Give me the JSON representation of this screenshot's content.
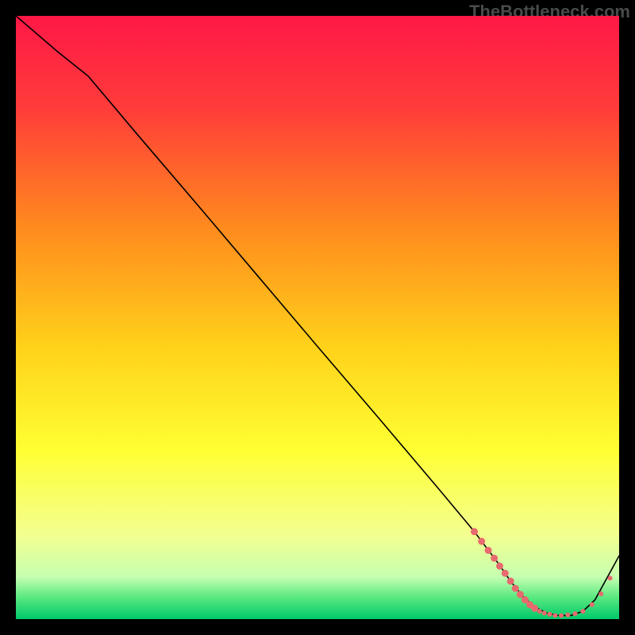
{
  "watermark": "TheBottleneck.com",
  "chart_data": {
    "type": "line",
    "title": "",
    "xlabel": "",
    "ylabel": "",
    "xlim": [
      0,
      100
    ],
    "ylim": [
      0,
      100
    ],
    "grid": false,
    "legend": false,
    "gradient_stops": [
      {
        "offset": 0.0,
        "color": "#ff1846"
      },
      {
        "offset": 0.15,
        "color": "#ff3b3a"
      },
      {
        "offset": 0.35,
        "color": "#ff8a1e"
      },
      {
        "offset": 0.55,
        "color": "#ffd21a"
      },
      {
        "offset": 0.72,
        "color": "#ffff33"
      },
      {
        "offset": 0.86,
        "color": "#f3ff8f"
      },
      {
        "offset": 0.93,
        "color": "#c6ffb0"
      },
      {
        "offset": 0.965,
        "color": "#56e87f"
      },
      {
        "offset": 1.0,
        "color": "#00c96a"
      }
    ],
    "series": [
      {
        "name": "curve",
        "stroke": "#000000",
        "stroke_width": 1.6,
        "x": [
          0,
          7,
          12,
          20,
          30,
          40,
          50,
          60,
          70,
          76,
          80,
          82,
          84,
          86,
          88,
          90,
          92,
          94,
          96,
          100
        ],
        "y": [
          100,
          94,
          90,
          80.5,
          68.8,
          57,
          45.2,
          33.5,
          21.7,
          14.5,
          9.2,
          6.3,
          3.8,
          2.0,
          1.0,
          0.6,
          0.6,
          1.3,
          3.2,
          10.5
        ]
      }
    ],
    "markers": {
      "color": "#e86a6f",
      "radius_small": 3.0,
      "radius_large": 4.5,
      "points": [
        {
          "x": 76.0,
          "y": 14.5,
          "r": "large"
        },
        {
          "x": 77.2,
          "y": 12.9,
          "r": "large"
        },
        {
          "x": 78.3,
          "y": 11.4,
          "r": "large"
        },
        {
          "x": 79.3,
          "y": 10.1,
          "r": "large"
        },
        {
          "x": 80.2,
          "y": 8.8,
          "r": "large"
        },
        {
          "x": 81.1,
          "y": 7.6,
          "r": "large"
        },
        {
          "x": 82.0,
          "y": 6.3,
          "r": "large"
        },
        {
          "x": 82.8,
          "y": 5.1,
          "r": "large"
        },
        {
          "x": 83.6,
          "y": 4.1,
          "r": "large"
        },
        {
          "x": 84.4,
          "y": 3.2,
          "r": "large"
        },
        {
          "x": 85.2,
          "y": 2.4,
          "r": "large"
        },
        {
          "x": 86.0,
          "y": 1.8,
          "r": "large"
        },
        {
          "x": 86.8,
          "y": 1.3,
          "r": "small"
        },
        {
          "x": 87.6,
          "y": 1.0,
          "r": "small"
        },
        {
          "x": 88.5,
          "y": 0.8,
          "r": "small"
        },
        {
          "x": 89.4,
          "y": 0.6,
          "r": "small"
        },
        {
          "x": 90.4,
          "y": 0.6,
          "r": "small"
        },
        {
          "x": 91.5,
          "y": 0.7,
          "r": "small"
        },
        {
          "x": 92.7,
          "y": 0.9,
          "r": "small"
        },
        {
          "x": 94.0,
          "y": 1.3,
          "r": "small"
        },
        {
          "x": 95.5,
          "y": 2.4,
          "r": "small"
        },
        {
          "x": 97.0,
          "y": 4.2,
          "r": "small"
        },
        {
          "x": 98.5,
          "y": 6.8,
          "r": "small"
        }
      ]
    }
  }
}
